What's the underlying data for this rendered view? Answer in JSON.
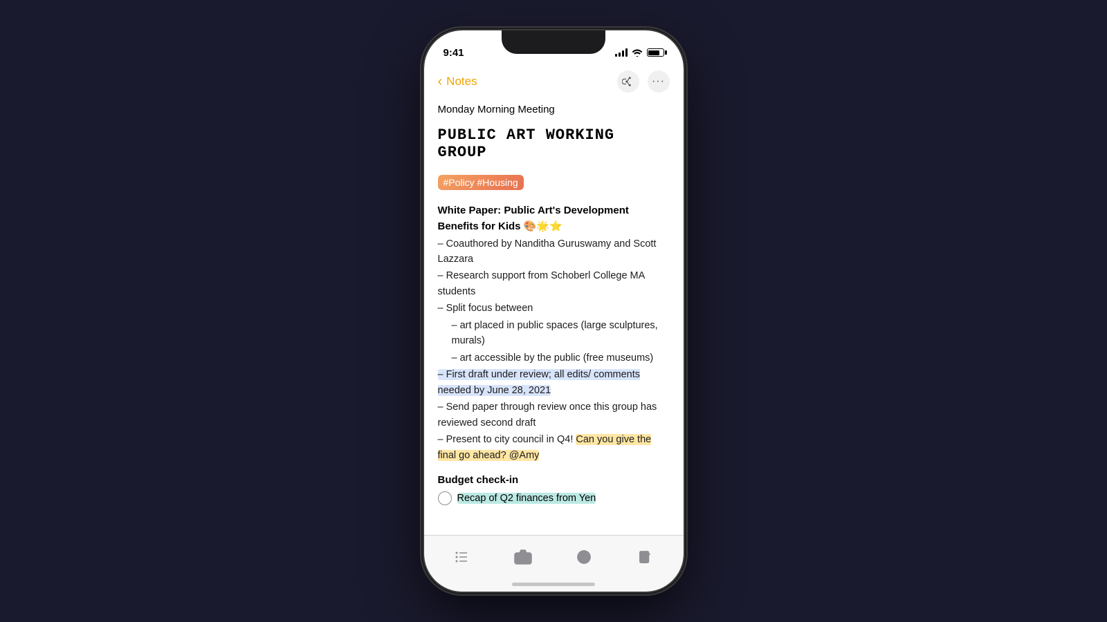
{
  "phone": {
    "status_bar": {
      "time": "9:41"
    },
    "nav": {
      "back_label": "Notes",
      "share_icon": "share-icon",
      "more_icon": "more-icon"
    },
    "note": {
      "subtitle": "Monday Morning Meeting",
      "title": "PUBLIC ART WORKING GROUP",
      "hashtags": "#Policy #Housing",
      "white_paper": {
        "heading": "White Paper: Public Art's Development Benefits for Kids 🎨🌟⭐",
        "bullets": [
          "– Coauthored by Nanditha Guruswamy and Scott Lazzara",
          "– Research support from Schoberl College MA students",
          "– Split focus between",
          "– art placed in public spaces (large sculptures, murals)",
          "– art accessible by the public (free museums)",
          "– First draft under review; all edits/ comments needed by June 28, 2021",
          "– Send paper through review once this group has reviewed second draft",
          "– Present to city council in Q4!",
          "Can you give the final go ahead? @Amy"
        ]
      },
      "budget": {
        "heading": "Budget check-in",
        "checkbox_item": "Recap of Q2 finances from Yen"
      }
    },
    "toolbar": {
      "checklist_icon": "checklist-icon",
      "camera_icon": "camera-icon",
      "markup_icon": "markup-icon",
      "compose_icon": "compose-icon"
    }
  }
}
